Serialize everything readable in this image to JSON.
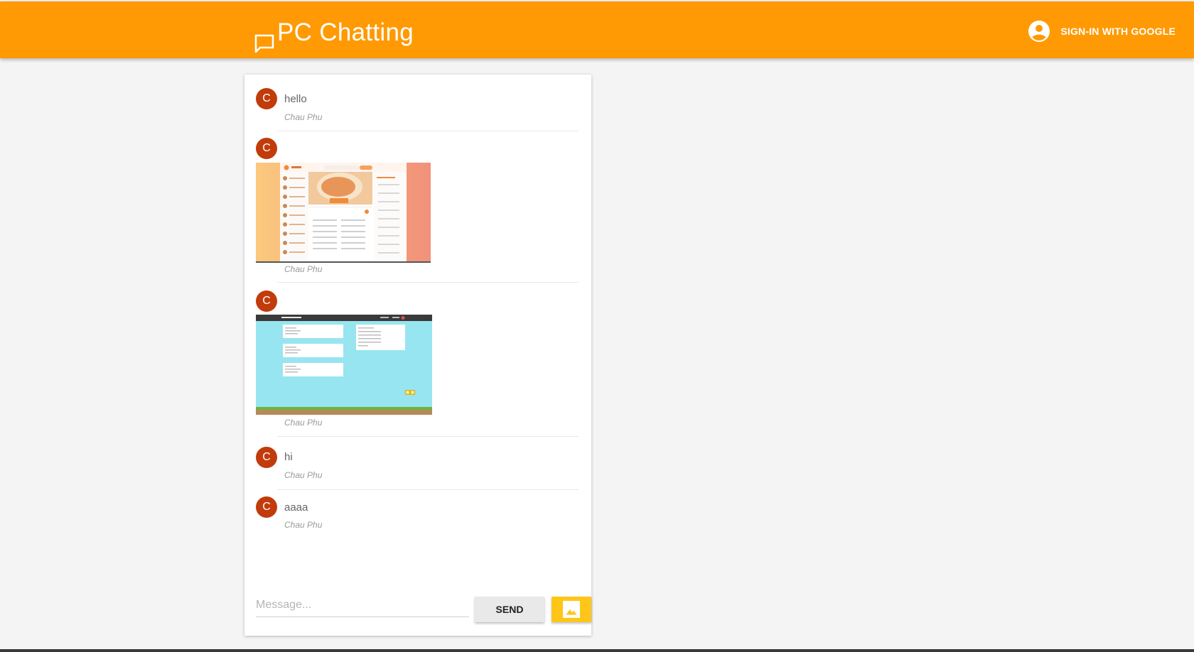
{
  "header": {
    "app_icon": "chat-bubble-icon",
    "app_title": "PC Chatting",
    "signin_icon": "account-circle-icon",
    "signin_label": "SIGN-IN WITH GOOGLE",
    "bar_color": "#ff9a04"
  },
  "messages": [
    {
      "avatar": "C",
      "type": "text",
      "text": "hello",
      "author": "Chau Phu"
    },
    {
      "avatar": "C",
      "type": "image",
      "image": "recipe-app-screenshot",
      "author": "Chau Phu"
    },
    {
      "avatar": "C",
      "type": "image",
      "image": "planner-game-screenshot",
      "author": "Chau Phu"
    },
    {
      "avatar": "C",
      "type": "text",
      "text": "hi",
      "author": "Chau Phu"
    },
    {
      "avatar": "C",
      "type": "text",
      "text": "aaaa",
      "author": "Chau Phu"
    }
  ],
  "composer": {
    "placeholder": "Message...",
    "value": "",
    "send_label": "SEND",
    "image_icon": "image-icon"
  },
  "colors": {
    "avatar": "#c23b0b",
    "image_button": "#ffc61a"
  }
}
